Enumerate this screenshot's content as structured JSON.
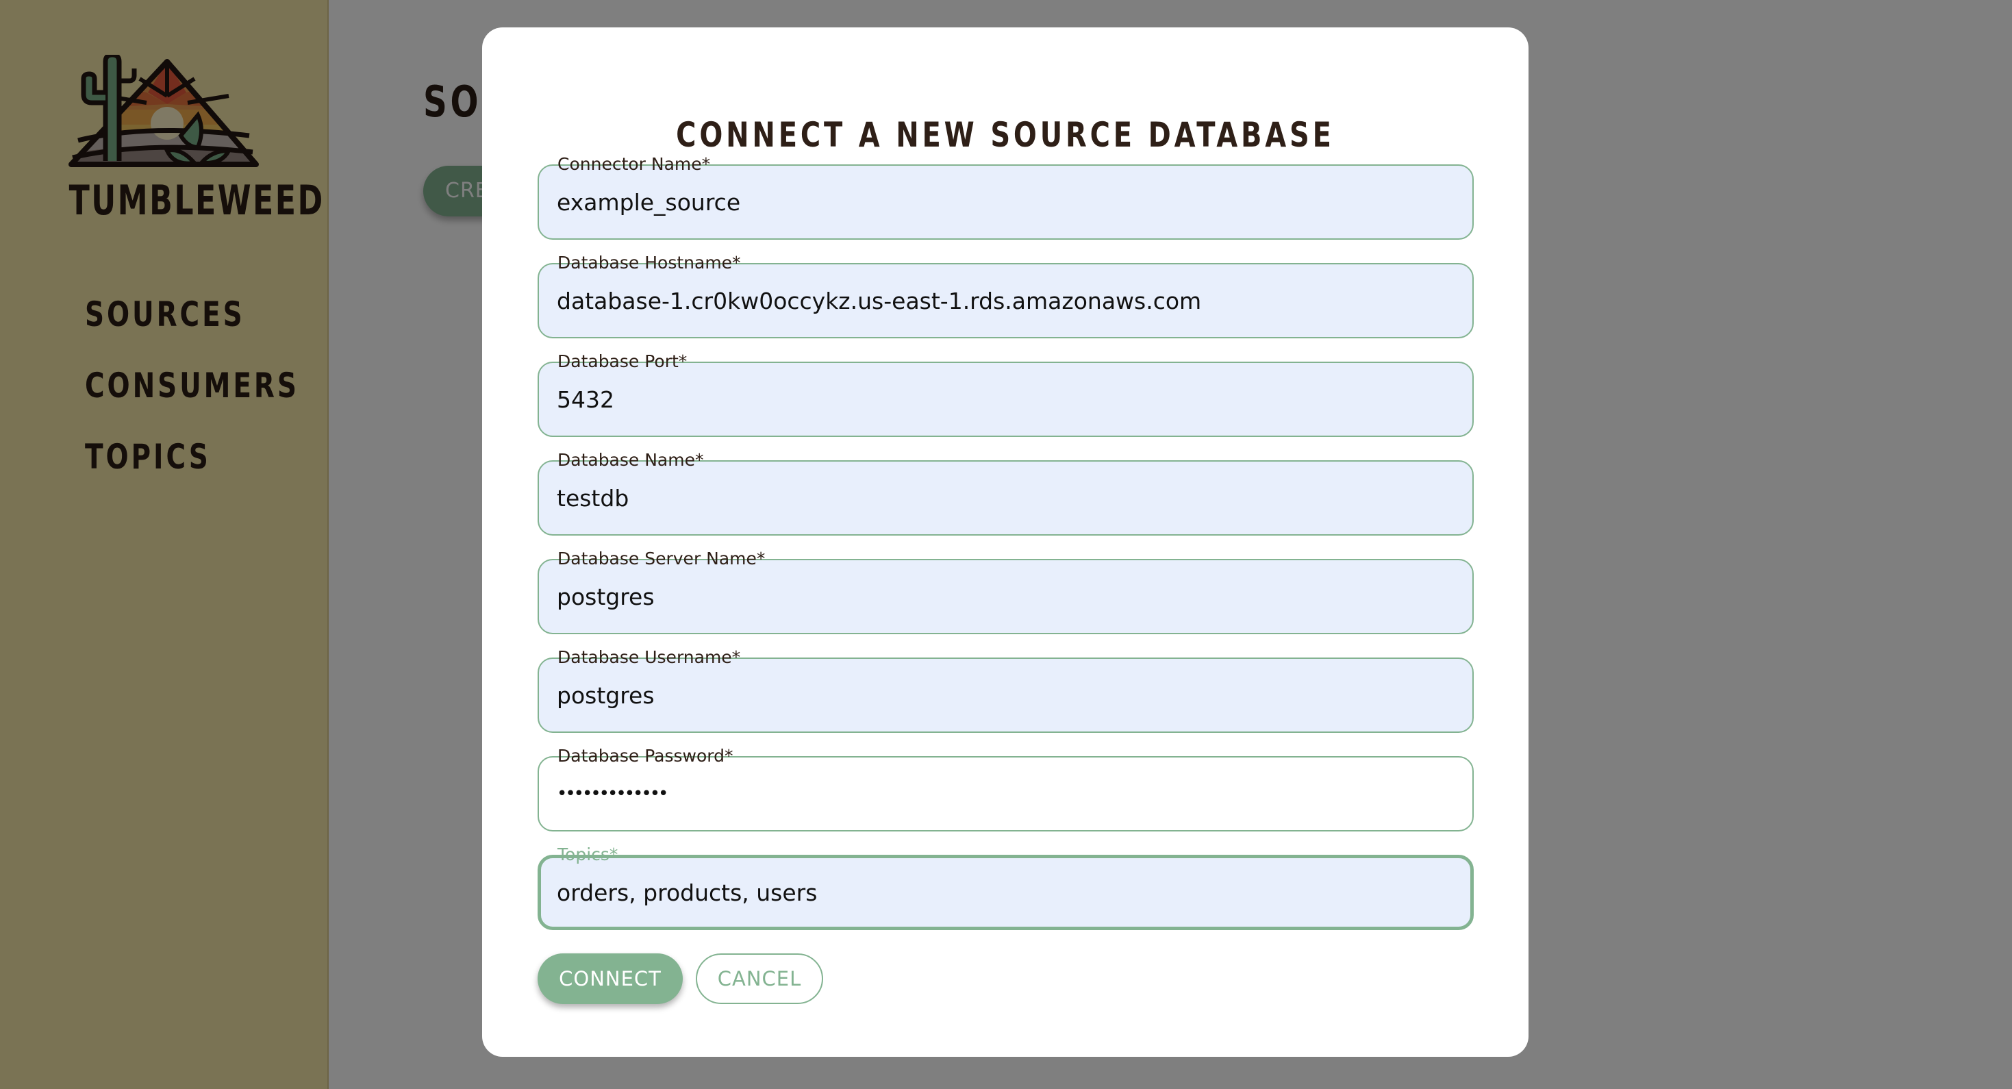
{
  "app": {
    "brand": "TUMBLEWEED"
  },
  "sidebar": {
    "items": [
      {
        "label": "SOURCES"
      },
      {
        "label": "CONSUMERS"
      },
      {
        "label": "TOPICS"
      }
    ]
  },
  "page": {
    "title": "SOURCES",
    "create_button_label": "CREATE NEW SOURCE"
  },
  "modal": {
    "title": "CONNECT A NEW SOURCE DATABASE",
    "fields": [
      {
        "label": "Connector Name*",
        "value": "example_source",
        "type": "text"
      },
      {
        "label": "Database Hostname*",
        "value": "database-1.cr0kw0occykz.us-east-1.rds.amazonaws.com",
        "type": "text"
      },
      {
        "label": "Database Port*",
        "value": "5432",
        "type": "text"
      },
      {
        "label": "Database Name*",
        "value": "testdb",
        "type": "text"
      },
      {
        "label": "Database Server Name*",
        "value": "postgres",
        "type": "text"
      },
      {
        "label": "Database Username*",
        "value": "postgres",
        "type": "text"
      },
      {
        "label": "Database Password*",
        "value": "•••••••••••••",
        "type": "password"
      },
      {
        "label": "Topics*",
        "value": "orders, products, users",
        "type": "text",
        "focused": true
      }
    ],
    "connect_label": "CONNECT",
    "cancel_label": "CANCEL"
  },
  "colors": {
    "accent": "#83b391",
    "sidebar_bg": "#f5e6a8",
    "text_dark": "#2e1f17",
    "input_bg": "#e8effc",
    "overlay": "#808080"
  }
}
